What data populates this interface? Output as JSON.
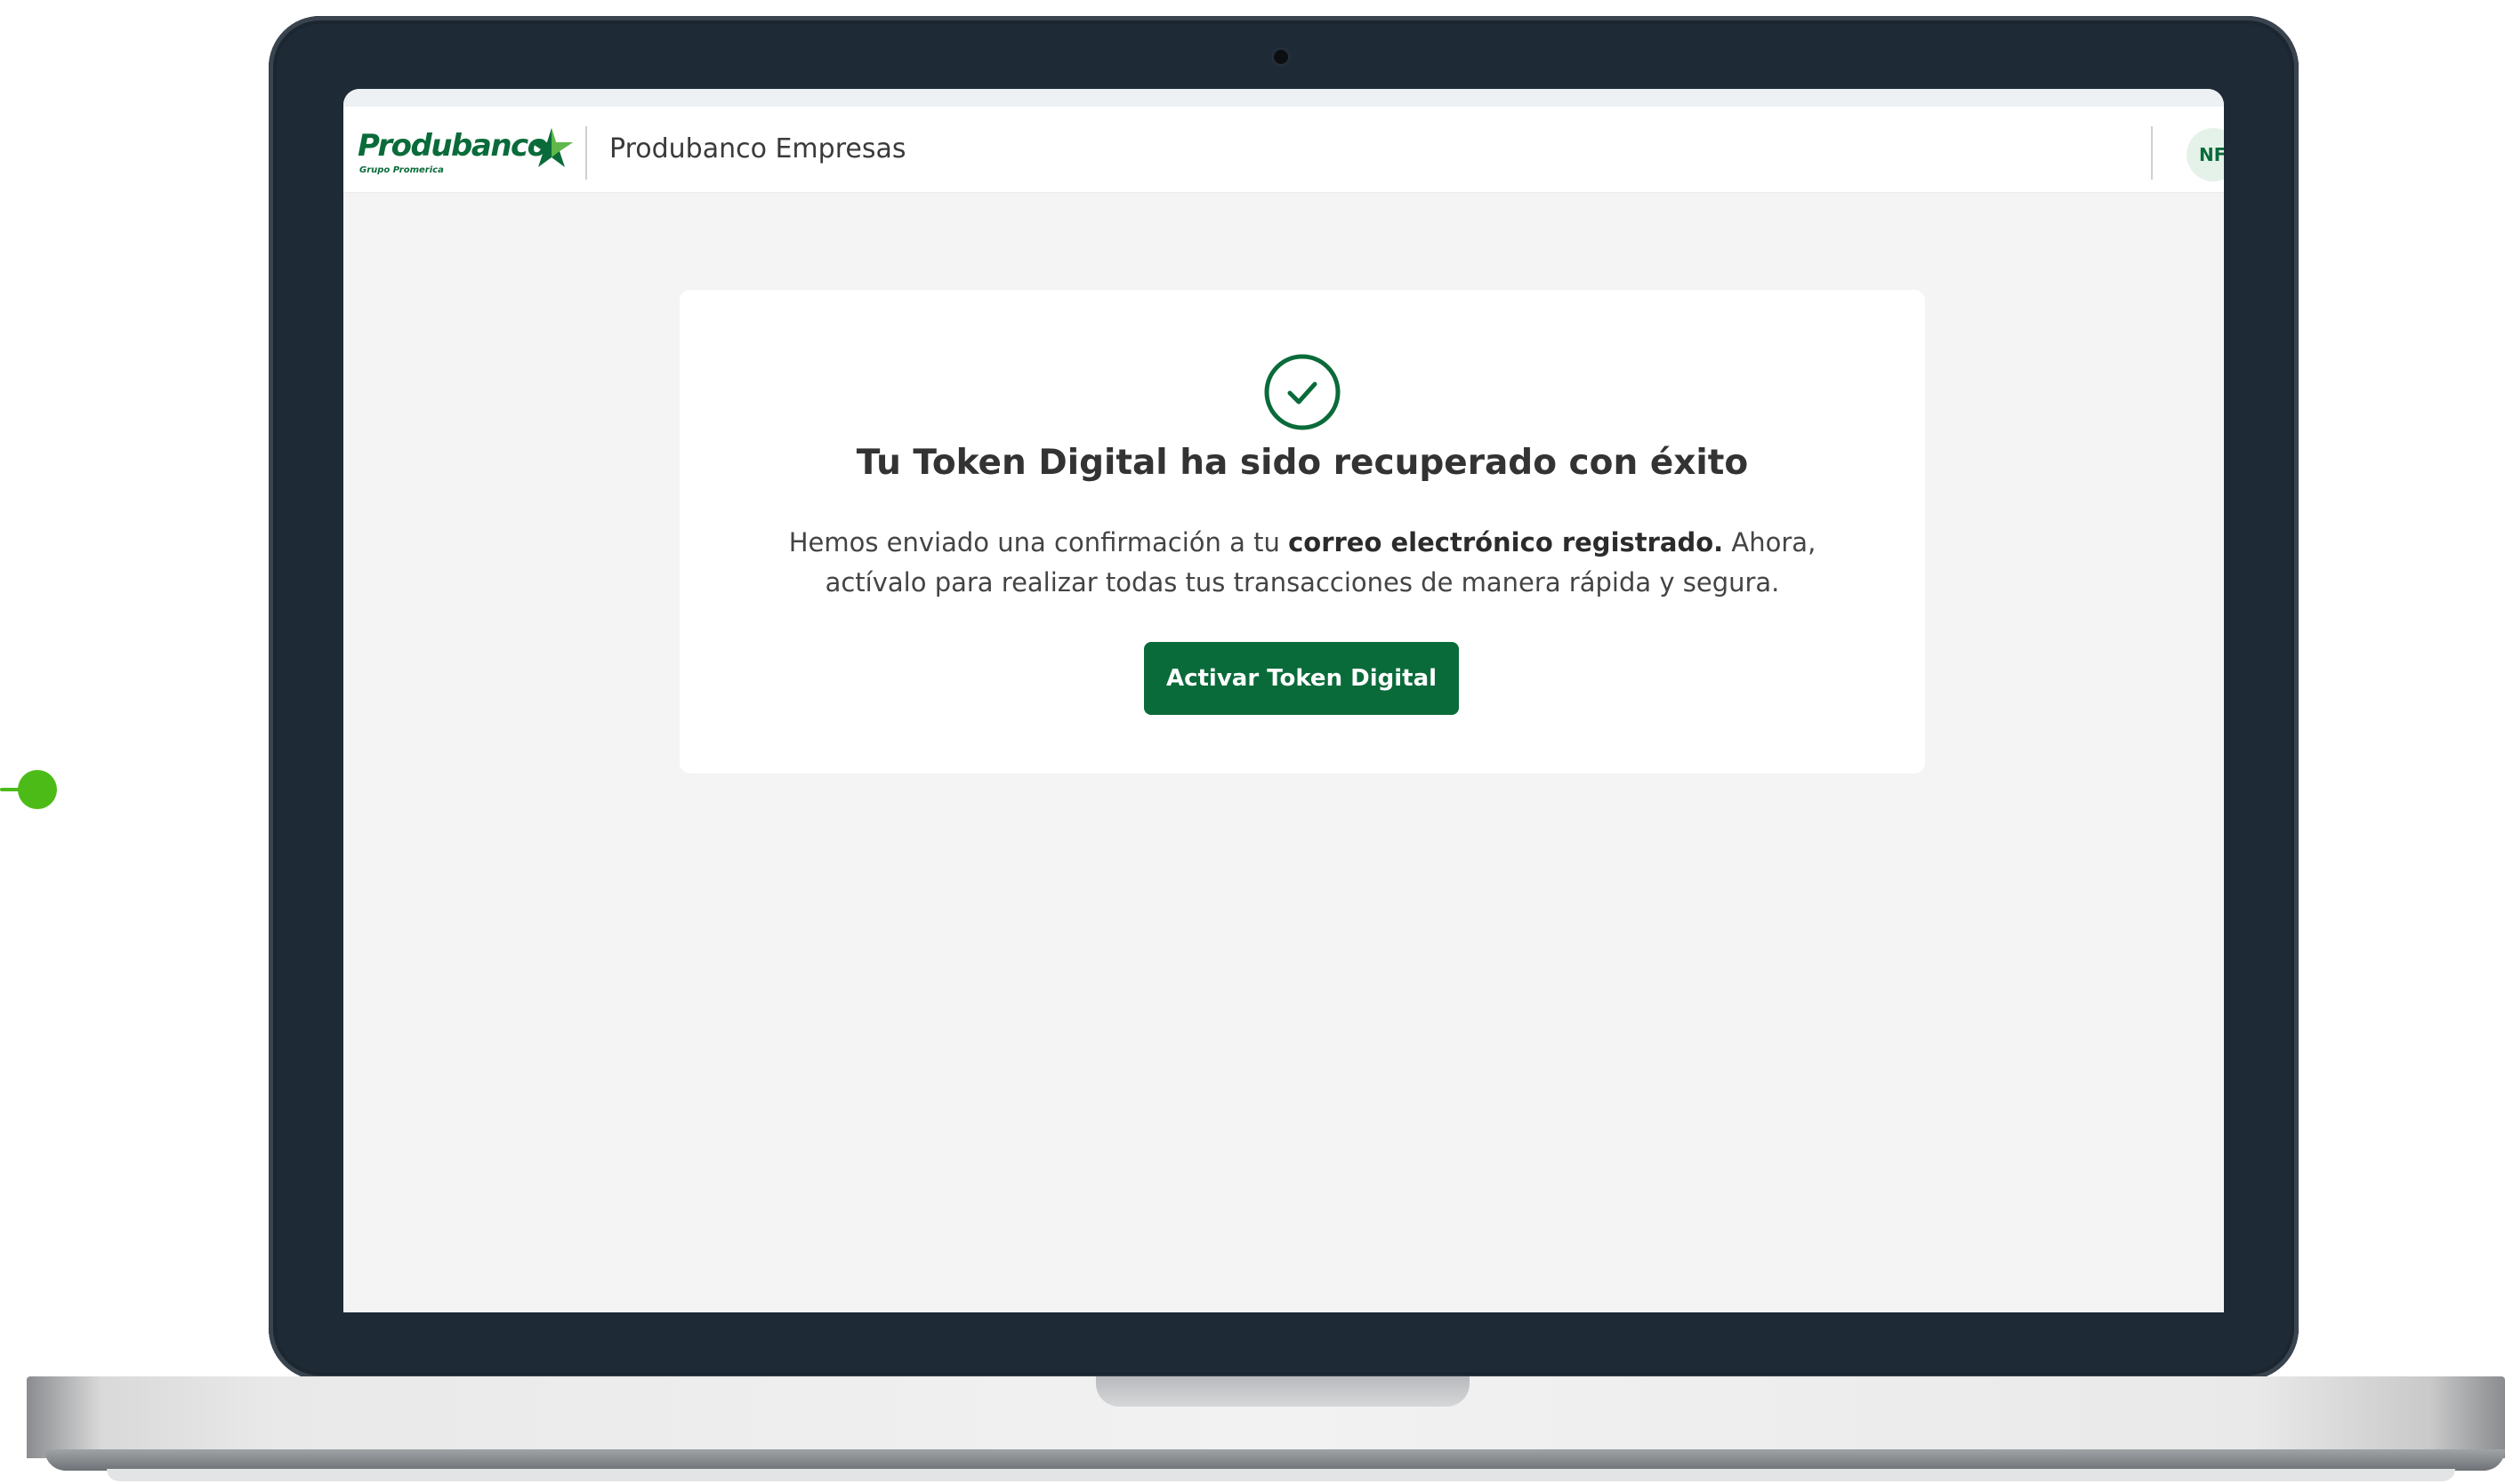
{
  "header": {
    "logo_text": "Produbanco",
    "logo_subtext": "Grupo Promerica",
    "app_title": "Produbanco Empresas",
    "avatar_initials": "NF"
  },
  "card": {
    "icon": "check-circle-icon",
    "title": "Tu Token Digital ha sido recuperado con éxito",
    "text_prefix": "Hemos enviado una confirmación a tu ",
    "text_bold": "correo electrónico registrado.",
    "text_suffix": " Ahora, actívalo para realizar todas tus transacciones de manera rápida y segura.",
    "button_label": "Activar Token Digital"
  },
  "colors": {
    "brand_green": "#0a6b3a",
    "connector_green": "#4cbb17",
    "page_background": "#f4f4f4"
  }
}
